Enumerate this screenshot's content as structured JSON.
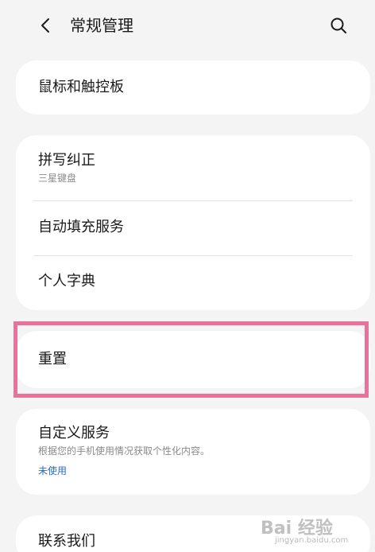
{
  "header": {
    "title": "常规管理",
    "back_icon": "chevron-left-icon",
    "search_icon": "search-icon"
  },
  "cards": {
    "mouse": {
      "title": "鼠标和触控板"
    },
    "spell": {
      "title": "拼写纠正",
      "subtitle": "三星键盘"
    },
    "autofill": {
      "title": "自动填充服务"
    },
    "dictionary": {
      "title": "个人字典"
    },
    "reset": {
      "title": "重置"
    },
    "custom": {
      "title": "自定义服务",
      "subtitle": "根据您的手机使用情况获取个性化内容。",
      "status": "未使用"
    },
    "contact": {
      "title": "联系我们"
    }
  },
  "highlight": {
    "color": "#e8729c"
  },
  "watermark": {
    "text": "Bai 经验",
    "sub": "jingyan.baidu.com"
  }
}
